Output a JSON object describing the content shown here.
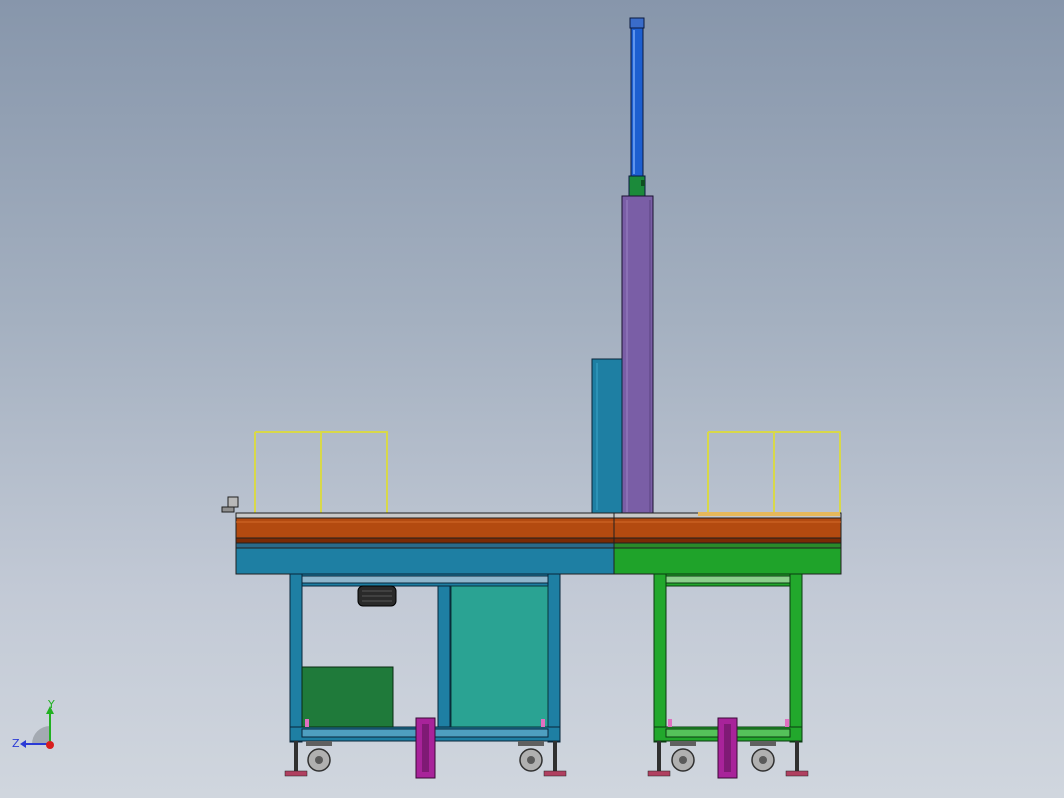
{
  "triad": {
    "y_label": "Y",
    "z_label": "Z"
  },
  "colors": {
    "background_top": "#8796ab",
    "background_bottom": "#d0d6de",
    "mast": "#7a5ea6",
    "cylinder": "#1d5fd0",
    "cylinder_mount": "#1b8a3a",
    "cabinet": "#1e7fa3",
    "deck_orange": "#b34a10",
    "deck_dark": "#7a2a05",
    "left_beam": "#1e7fa3",
    "right_beam": "#1fa32a",
    "left_frame": "#1e7fa3",
    "right_frame": "#22a82c",
    "teal_panel": "#2aa393",
    "green_box": "#1f7a3a",
    "railing": "#e6e65a",
    "feet": "#a8239a",
    "caster": "#a7a7a7",
    "axis_x": "#d81e1e",
    "axis_y": "#21b021",
    "axis_z": "#2b3bd6"
  }
}
